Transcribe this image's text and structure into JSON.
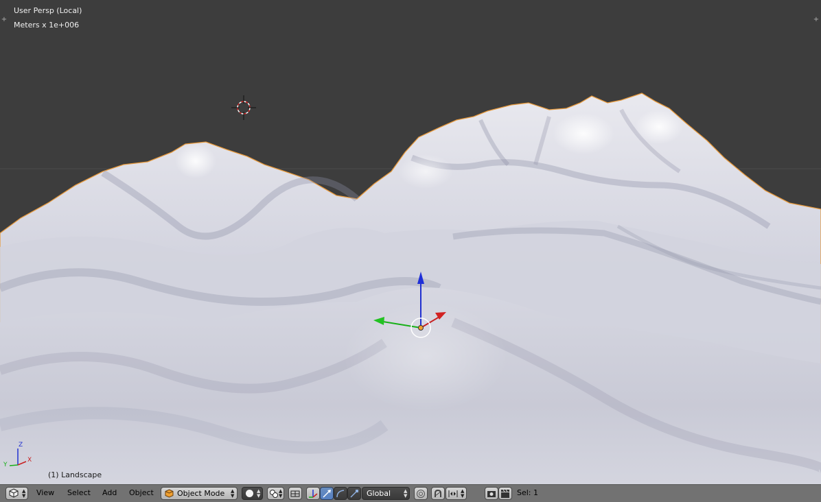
{
  "viewport": {
    "view_name": "User Persp (Local)",
    "units": "Meters x 1e+006",
    "object_label": "(1) Landscape",
    "colors": {
      "background": "#3d3d3d",
      "terrain": "#d5d6e0",
      "outline": "#e89a3c"
    }
  },
  "header": {
    "menus": [
      "View",
      "Select",
      "Add",
      "Object"
    ],
    "mode": "Object Mode",
    "orientation": "Global",
    "selection": "Sel: 1",
    "icons": [
      "editor-type-icon",
      "viewport-shading-icon",
      "pivot-point-icon",
      "manipulator-toggle-icon",
      "translate-icon",
      "rotate-icon",
      "scale-icon",
      "proportional-edit-icon",
      "snap-magnet-icon",
      "snap-element-icon",
      "render-icon",
      "render-animation-icon"
    ]
  },
  "axis_labels": {
    "x": "X",
    "y": "Y",
    "z": "Z"
  }
}
